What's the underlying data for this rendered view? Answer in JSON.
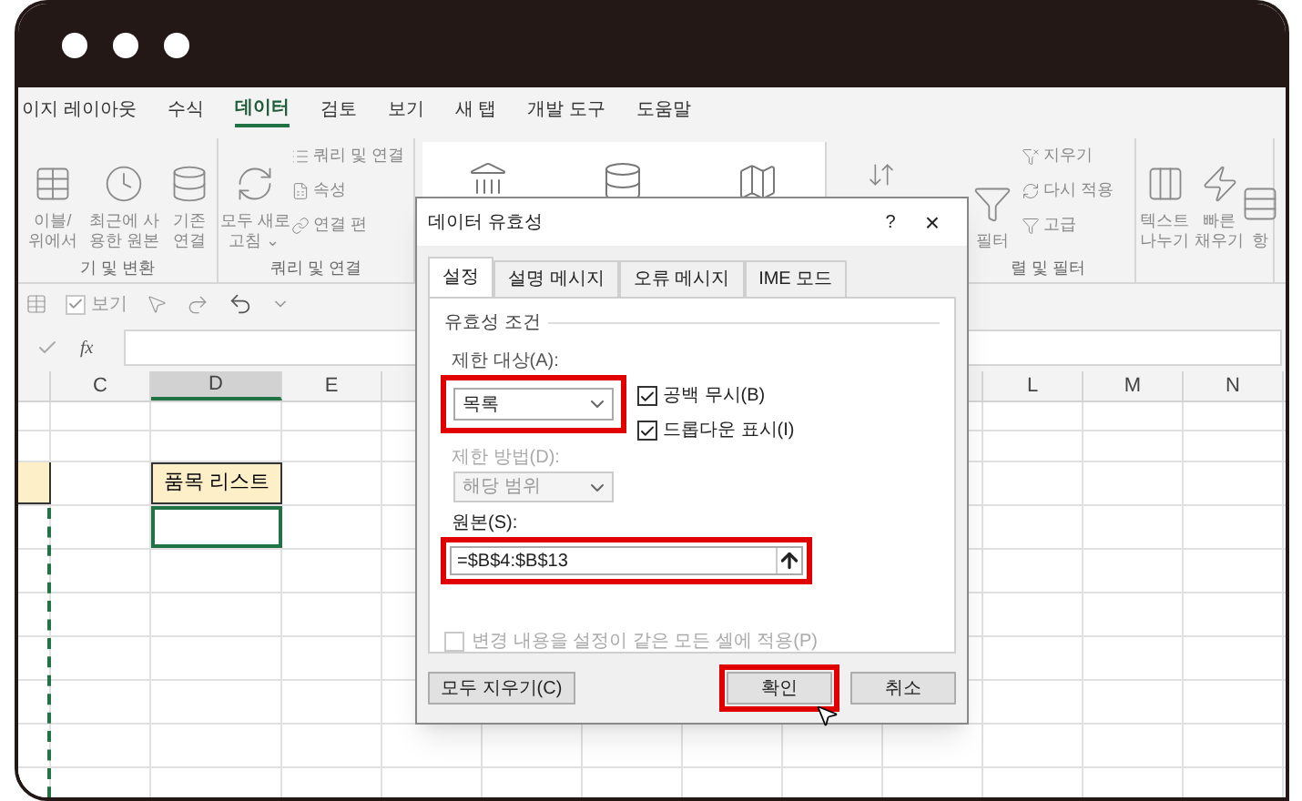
{
  "ribbon": {
    "tabs": [
      {
        "label": "이지 레이아웃",
        "selected": false
      },
      {
        "label": "수식",
        "selected": false
      },
      {
        "label": "데이터",
        "selected": true
      },
      {
        "label": "검토",
        "selected": false
      },
      {
        "label": "보기",
        "selected": false
      },
      {
        "label": "새 탭",
        "selected": false
      },
      {
        "label": "개발 도구",
        "selected": false
      },
      {
        "label": "도움말",
        "selected": false
      }
    ],
    "groups": [
      {
        "label": "기 및 변환",
        "buttons": [
          {
            "kind": "large",
            "lines": [
              "이블/",
              "위에서"
            ]
          },
          {
            "kind": "large",
            "lines": [
              "최근에 사",
              "용한 원본"
            ]
          },
          {
            "kind": "large",
            "lines": [
              "기존",
              "연결"
            ]
          }
        ]
      },
      {
        "label": "쿼리 및 연결",
        "buttons": [
          {
            "kind": "large",
            "lines": [
              "모두 새로",
              "고침 ⌄"
            ]
          },
          {
            "kind": "small",
            "lines": [
              "쿼리 및 연결"
            ]
          },
          {
            "kind": "small",
            "lines": [
              "속성"
            ]
          },
          {
            "kind": "small",
            "lines": [
              "연결 편"
            ]
          }
        ]
      },
      {
        "label": "렬 및 필터",
        "buttons": [
          {
            "kind": "large",
            "lines": [
              "필터"
            ]
          },
          {
            "kind": "small",
            "lines": [
              "지우기"
            ]
          },
          {
            "kind": "small",
            "lines": [
              "다시 적용"
            ]
          },
          {
            "kind": "small",
            "lines": [
              "고급"
            ]
          }
        ]
      },
      {
        "buttons": [
          {
            "kind": "large",
            "lines": [
              "텍스트",
              "나누기"
            ]
          },
          {
            "kind": "large",
            "lines": [
              "빠른",
              "채우기"
            ]
          },
          {
            "kind": "large",
            "lines": [
              "항"
            ]
          }
        ]
      }
    ]
  },
  "quick_access": {
    "view_label": "보기",
    "view_checked": true
  },
  "formula_bar": {
    "fx": "fx"
  },
  "sheet": {
    "columns": [
      {
        "label": "C",
        "selected": false
      },
      {
        "label": "D",
        "selected": true
      },
      {
        "label": "E",
        "selected": false
      },
      {
        "label": "L",
        "selected": false
      },
      {
        "label": "M",
        "selected": false
      },
      {
        "label": "N",
        "selected": false
      }
    ],
    "header_cell": "품목 리스트"
  },
  "dialog": {
    "title": "데이터 유효성",
    "help": "?",
    "close": "×",
    "tabs": [
      {
        "label": "설정",
        "selected": true
      },
      {
        "label": "설명 메시지",
        "selected": false
      },
      {
        "label": "오류 메시지",
        "selected": false
      },
      {
        "label": "IME 모드",
        "selected": false
      }
    ],
    "section": "유효성 조건",
    "allow_label": "제한 대상(A):",
    "allow_value": "목록",
    "checks": [
      {
        "label": "공백 무시(B)",
        "checked": true
      },
      {
        "label": "드롭다운 표시(I)",
        "checked": true
      }
    ],
    "data_label": "제한 방법(D):",
    "data_value": "해당 범위",
    "data_disabled": true,
    "source_label": "원본(S):",
    "source_value": "=$B$4:$B$13",
    "apply_all": {
      "label": "변경 내용을 설정이 같은 모든 셀에 적용(P)",
      "checked": false,
      "disabled": true
    },
    "buttons": [
      {
        "label": "모두 지우기(C)",
        "kind": "clear",
        "highlighted": false
      },
      {
        "label": "확인",
        "kind": "ok",
        "highlighted": true
      },
      {
        "label": "취소",
        "kind": "cancel",
        "highlighted": false
      }
    ]
  }
}
